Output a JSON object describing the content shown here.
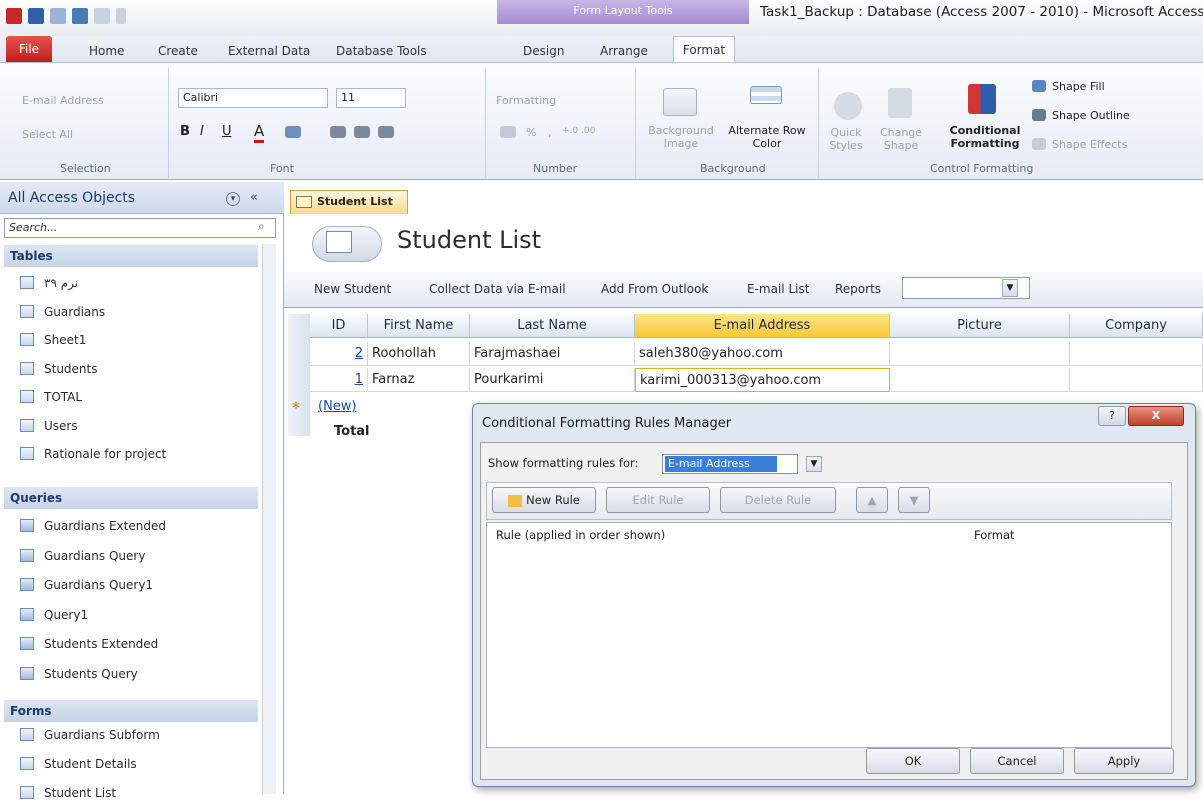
{
  "titlebar": {
    "context_group": "Form Layout Tools",
    "app_title": "Task1_Backup : Database (Access 2007 - 2010)  -  Microsoft Access"
  },
  "tabs": {
    "file": "File",
    "home": "Home",
    "create": "Create",
    "external": "External Data",
    "dbtools": "Database Tools",
    "design": "Design",
    "arrange": "Arrange",
    "format": "Format"
  },
  "ribbon": {
    "selection": {
      "object": "E-mail Address",
      "select_all": "Select All",
      "label": "Selection"
    },
    "font": {
      "family": "Calibri",
      "size": "11",
      "label": "Font",
      "bold": "B",
      "italic": "I",
      "underline": "U",
      "font_color_glyph": "A"
    },
    "number": {
      "formatting": "Formatting",
      "label": "Number",
      "percent": "%",
      "comma": ",",
      "inc": "+.0 .00",
      "dec": ".00 +.0"
    },
    "background": {
      "bg_image": "Background Image",
      "alt_row": "Alternate Row Color",
      "label": "Background"
    },
    "control": {
      "quick": "Quick Styles",
      "change": "Change Shape",
      "conditional": "Conditional Formatting",
      "fill": "Shape Fill",
      "outline": "Shape Outline",
      "effects": "Shape Effects",
      "label": "Control Formatting"
    }
  },
  "nav": {
    "title": "All Access Objects",
    "search": "Search...",
    "sections": [
      {
        "name": "Tables",
        "items": [
          "نرم ۳۹",
          "Guardians",
          "Sheet1",
          "Students",
          "TOTAL",
          "Users",
          "Rationale for project"
        ]
      },
      {
        "name": "Queries",
        "items": [
          "Guardians Extended",
          "Guardians Query",
          "Guardians Query1",
          "Query1",
          "Students Extended",
          "Students Query"
        ]
      },
      {
        "name": "Forms",
        "items": [
          "Guardians Subform",
          "Student Details",
          "Student List"
        ]
      }
    ]
  },
  "document": {
    "tab": "Student List",
    "title": "Student List"
  },
  "toolbar": {
    "new": "New Student",
    "collect": "Collect Data via E-mail",
    "outlook": "Add From Outlook",
    "email_list": "E-mail List",
    "reports": "Reports"
  },
  "grid": {
    "headers": [
      "ID",
      "First Name",
      "Last Name",
      "E-mail Address",
      "Picture",
      "Company"
    ],
    "rows": [
      {
        "id": "2",
        "first": "Roohollah",
        "last": "Farajmashaei",
        "email": "saleh380@yahoo.com"
      },
      {
        "id": "1",
        "first": "Farnaz",
        "last": "Pourkarimi",
        "email": "karimi_000313@yahoo.com"
      }
    ],
    "new_row": "(New)",
    "new_marker": "*",
    "total": "Total"
  },
  "dialog": {
    "title": "Conditional Formatting Rules Manager",
    "show_for_label": "Show formatting rules for:",
    "show_for_value": "E-mail Address",
    "new_rule": "New Rule",
    "edit_rule": "Edit Rule",
    "delete_rule": "Delete Rule",
    "col_rule": "Rule (applied in order shown)",
    "col_format": "Format",
    "ok": "OK",
    "cancel": "Cancel",
    "apply": "Apply",
    "help": "?",
    "close": "X"
  },
  "colors": {
    "accent": "#e8534f",
    "context": "#a58bd4",
    "selected_header": "#f9d24a"
  }
}
